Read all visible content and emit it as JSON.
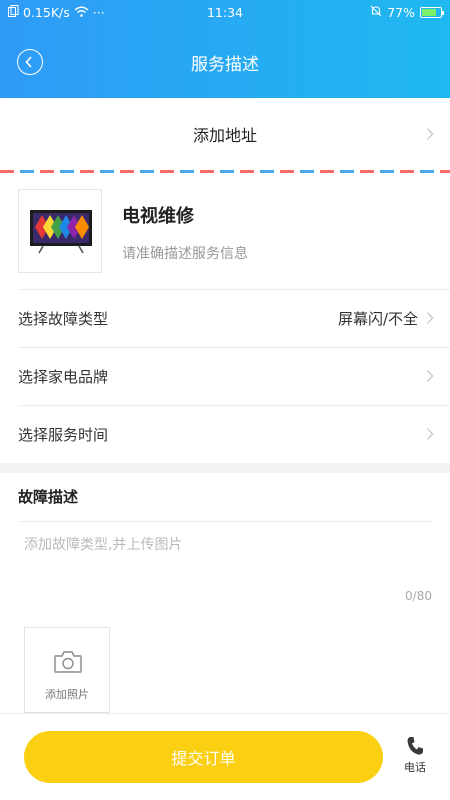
{
  "status_bar": {
    "speed": "0.15K/s",
    "dots": "···",
    "time": "11:34",
    "battery_pct": "77%",
    "battery_level": 0.77
  },
  "nav": {
    "title": "服务描述"
  },
  "address": {
    "label": "添加地址"
  },
  "product": {
    "name": "电视维修",
    "subtitle": "请准确描述服务信息"
  },
  "options": [
    {
      "label": "选择故障类型",
      "value": "屏幕闪/不全"
    },
    {
      "label": "选择家电品牌",
      "value": ""
    },
    {
      "label": "选择服务时间",
      "value": ""
    }
  ],
  "fault": {
    "title": "故障描述",
    "placeholder": "添加故障类型,并上传图片",
    "counter": "0/80",
    "add_photo_label": "添加照片"
  },
  "footer": {
    "submit_label": "提交订单",
    "phone_label": "电话"
  },
  "colors": {
    "header_start": "#2f9bf6",
    "header_end": "#1fb8f0",
    "submit": "#fbcf12"
  }
}
